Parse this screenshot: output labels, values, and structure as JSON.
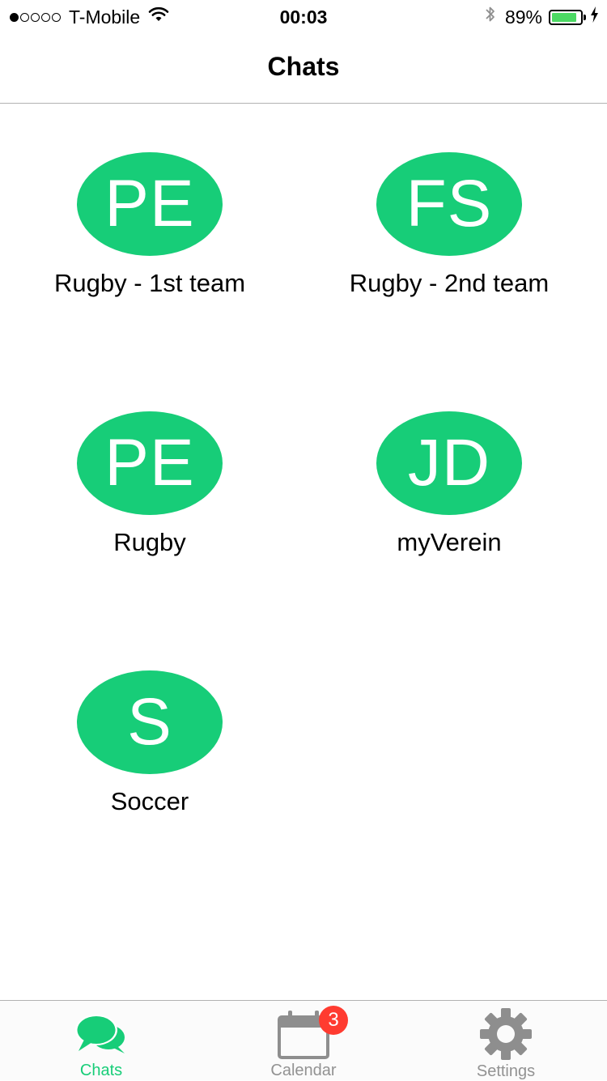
{
  "status_bar": {
    "signal_filled": 1,
    "signal_total": 5,
    "carrier": "T-Mobile",
    "time": "00:03",
    "battery_percent_label": "89%",
    "battery_level": 0.89,
    "icons": [
      "wifi-icon",
      "bluetooth-icon",
      "battery-icon",
      "charging-bolt-icon"
    ]
  },
  "nav": {
    "title": "Chats"
  },
  "chats": [
    {
      "initials": "PE",
      "name": "Rugby - 1st team"
    },
    {
      "initials": "FS",
      "name": "Rugby - 2nd team"
    },
    {
      "initials": "PE",
      "name": "Rugby"
    },
    {
      "initials": "JD",
      "name": "myVerein"
    },
    {
      "initials": "S",
      "name": "Soccer"
    }
  ],
  "tab_bar": {
    "tabs": [
      {
        "label": "Chats",
        "icon": "chat-bubbles-icon",
        "active": true
      },
      {
        "label": "Calendar",
        "icon": "calendar-icon",
        "active": false,
        "badge": "3"
      },
      {
        "label": "Settings",
        "icon": "gear-icon",
        "active": false
      }
    ]
  },
  "colors": {
    "accent": "#17cd78",
    "tab_inactive": "#929292",
    "badge": "#ff3b30",
    "battery": "#4cd964"
  }
}
